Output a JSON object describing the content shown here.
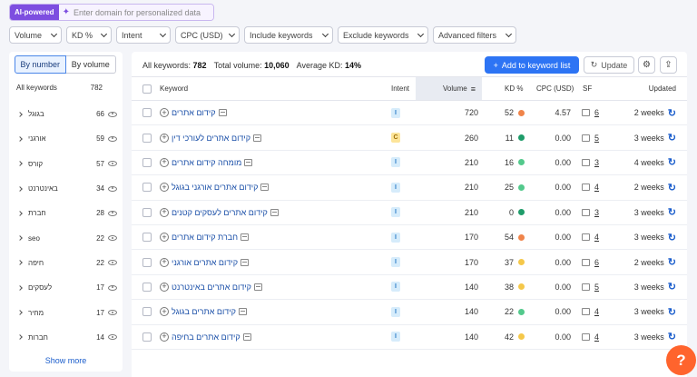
{
  "ai_bar": {
    "badge": "AI-powered",
    "placeholder": "Enter domain for personalized data"
  },
  "filters": [
    "Volume",
    "KD %",
    "Intent",
    "CPC (USD)",
    "Include keywords",
    "Exclude keywords",
    "Advanced filters"
  ],
  "left_panel": {
    "toggle": [
      "By number",
      "By volume"
    ],
    "header_label": "All keywords",
    "header_count": "782",
    "groups": [
      {
        "name": "בגוגל",
        "count": "66"
      },
      {
        "name": "אורגני",
        "count": "59"
      },
      {
        "name": "קורס",
        "count": "57"
      },
      {
        "name": "באינטרנט",
        "count": "34"
      },
      {
        "name": "חברת",
        "count": "28"
      },
      {
        "name": "seo",
        "count": "22"
      },
      {
        "name": "חיפה",
        "count": "22"
      },
      {
        "name": "לעסקים",
        "count": "17"
      },
      {
        "name": "מחיר",
        "count": "17"
      },
      {
        "name": "חברות",
        "count": "14"
      }
    ],
    "show_more": "Show more"
  },
  "summary": {
    "all_keywords_label": "All keywords:",
    "all_keywords_value": "782",
    "total_volume_label": "Total volume:",
    "total_volume_value": "10,060",
    "avg_kd_label": "Average KD:",
    "avg_kd_value": "14%"
  },
  "toolbar": {
    "add_label": "Add to keyword list",
    "update_label": "Update",
    "settings_icon": "gear-icon",
    "export_icon": "export-icon"
  },
  "table": {
    "headers": {
      "keyword": "Keyword",
      "intent": "Intent",
      "volume": "Volume",
      "kd": "KD %",
      "cpc": "CPC (USD)",
      "sf": "SF",
      "updated": "Updated"
    },
    "rows": [
      {
        "keyword": "קידום אתרים",
        "intent": "I",
        "volume": "720",
        "kd": "52",
        "kd_color": "#f0844a",
        "cpc": "4.57",
        "sf": "6",
        "updated": "2 weeks"
      },
      {
        "keyword": "קידום אתרים לעורכי דין",
        "intent": "C",
        "volume": "260",
        "kd": "11",
        "kd_color": "#1f9c6a",
        "cpc": "0.00",
        "sf": "5",
        "updated": "3 weeks"
      },
      {
        "keyword": "מומחה קידום אתרים",
        "intent": "I",
        "volume": "210",
        "kd": "16",
        "kd_color": "#53c98c",
        "cpc": "0.00",
        "sf": "3",
        "updated": "4 weeks"
      },
      {
        "keyword": "קידום אתרים אורגני בגוגל",
        "intent": "I",
        "volume": "210",
        "kd": "25",
        "kd_color": "#53c98c",
        "cpc": "0.00",
        "sf": "4",
        "updated": "2 weeks"
      },
      {
        "keyword": "קידום אתרים לעסקים קטנים",
        "intent": "I",
        "volume": "210",
        "kd": "0",
        "kd_color": "#1f9c6a",
        "cpc": "0.00",
        "sf": "3",
        "updated": "3 weeks"
      },
      {
        "keyword": "חברת קידום אתרים",
        "intent": "I",
        "volume": "170",
        "kd": "54",
        "kd_color": "#f0844a",
        "cpc": "0.00",
        "sf": "4",
        "updated": "3 weeks"
      },
      {
        "keyword": "קידום אתרים אורגני",
        "intent": "I",
        "volume": "170",
        "kd": "37",
        "kd_color": "#f5c84a",
        "cpc": "0.00",
        "sf": "6",
        "updated": "2 weeks"
      },
      {
        "keyword": "קידום אתרים באינטרנט",
        "intent": "I",
        "volume": "140",
        "kd": "38",
        "kd_color": "#f5c84a",
        "cpc": "0.00",
        "sf": "5",
        "updated": "3 weeks"
      },
      {
        "keyword": "קידום אתרים בגוגל",
        "intent": "I",
        "volume": "140",
        "kd": "22",
        "kd_color": "#53c98c",
        "cpc": "0.00",
        "sf": "4",
        "updated": "3 weeks"
      },
      {
        "keyword": "קידום אתרים בחיפה",
        "intent": "I",
        "volume": "140",
        "kd": "42",
        "kd_color": "#f5c84a",
        "cpc": "0.00",
        "sf": "4",
        "updated": "3 weeks"
      }
    ]
  },
  "help": {
    "label": "?",
    "color": "#ff642d"
  }
}
